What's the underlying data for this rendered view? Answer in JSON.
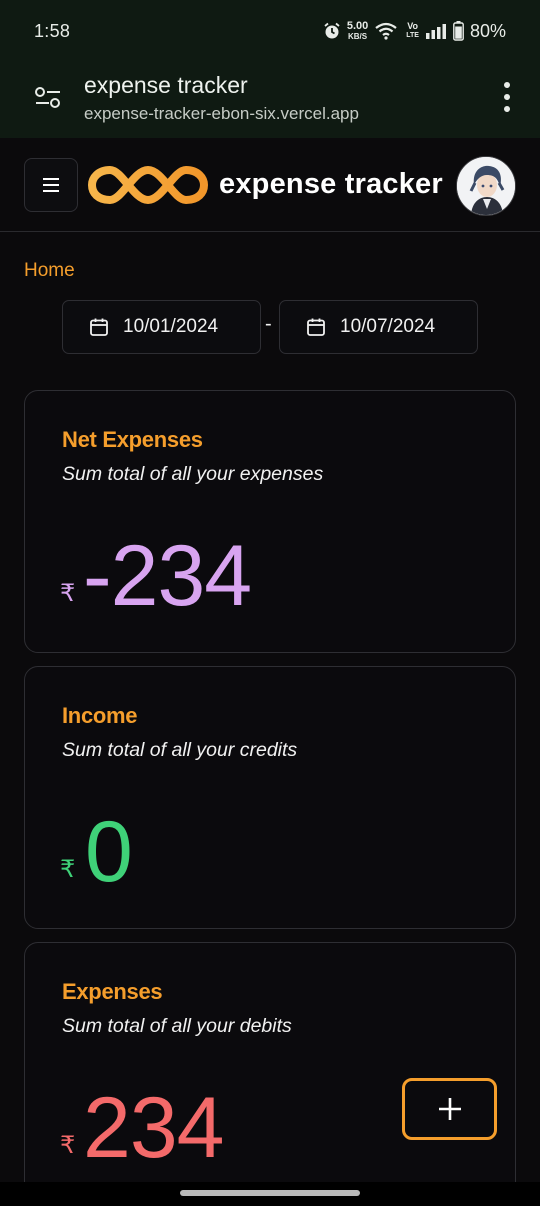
{
  "status_bar": {
    "time": "1:58",
    "speed_value": "5.00",
    "speed_unit": "KB/S",
    "volte_top": "Vo",
    "volte_bottom": "LTE",
    "battery": "80%"
  },
  "browser": {
    "page_title": "expense tracker",
    "url": "expense-tracker-ebon-six.vercel.app"
  },
  "header": {
    "brand": "expense tracker"
  },
  "breadcrumb": "Home",
  "date_range": {
    "start": "10/01/2024",
    "separator": "-",
    "end": "10/07/2024"
  },
  "cards": {
    "net": {
      "title": "Net Expenses",
      "subtitle": "Sum total of all your expenses",
      "currency": "₹",
      "amount": "-234",
      "color": "#d8a4f0"
    },
    "income": {
      "title": "Income",
      "subtitle": "Sum total of all your credits",
      "currency": "₹",
      "amount": "0",
      "color": "#3fd178"
    },
    "expenses": {
      "title": "Expenses",
      "subtitle": "Sum total of all your debits",
      "currency": "₹",
      "amount": "234",
      "color": "#f46a6a",
      "add_label": "+"
    }
  },
  "colors": {
    "accent": "#f59e2c",
    "background": "#0b0a0c"
  },
  "icons": [
    "tune-icon",
    "kebab-menu-icon",
    "hamburger-icon",
    "brand-logo",
    "calendar-icon",
    "plus-icon"
  ]
}
